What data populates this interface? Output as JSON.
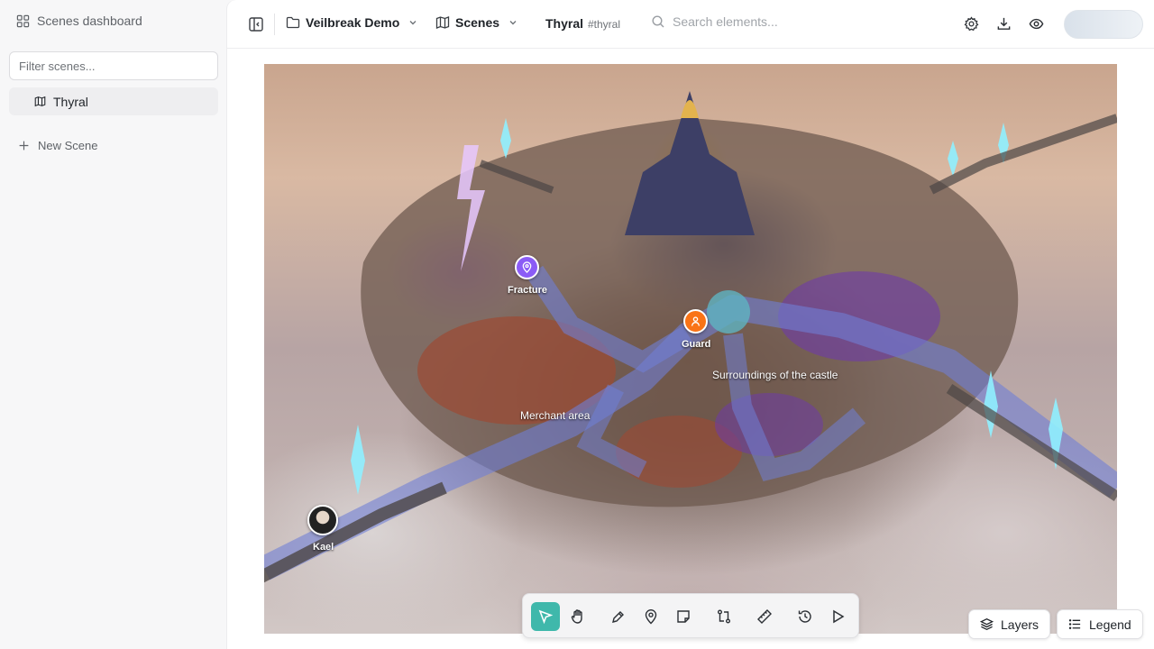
{
  "sidebar": {
    "title": "Scenes dashboard",
    "filter_placeholder": "Filter scenes...",
    "scenes": [
      {
        "label": "Thyral"
      }
    ],
    "new_scene_label": "New Scene"
  },
  "topbar": {
    "project": "Veilbreak Demo",
    "section": "Scenes",
    "scene_name": "Thyral",
    "scene_slug": "#thyral",
    "search_placeholder": "Search elements..."
  },
  "map": {
    "region_labels": [
      "Surroundings of the castle",
      "Merchant area"
    ],
    "markers": [
      {
        "label": "Fracture",
        "color": "#8b5cf6",
        "icon": "map-pin-icon"
      },
      {
        "label": "Guard",
        "color": "#f97316",
        "icon": "person-icon"
      },
      {
        "label": "Kael",
        "icon": "character-avatar"
      }
    ]
  },
  "toolbar": {
    "tools": [
      "select",
      "pan",
      "draw",
      "pin",
      "note",
      "route",
      "measure",
      "history",
      "play"
    ],
    "active_tool": "select",
    "accent": "#3fb8ab"
  },
  "buttons": {
    "layers": "Layers",
    "legend": "Legend"
  }
}
